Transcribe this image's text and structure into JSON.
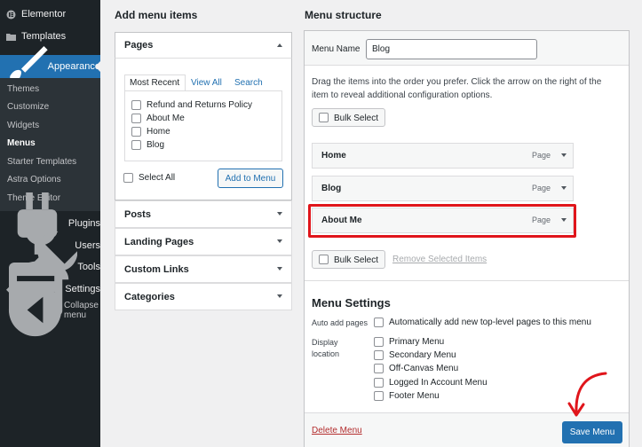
{
  "sidebar": {
    "elementor": "Elementor",
    "templates": "Templates",
    "appearance": "Appearance",
    "submenu": [
      "Themes",
      "Customize",
      "Widgets",
      "Menus",
      "Starter Templates",
      "Astra Options",
      "Theme Editor"
    ],
    "plugins": "Plugins",
    "users": "Users",
    "tools": "Tools",
    "settings": "Settings",
    "collapse": "Collapse menu"
  },
  "add_items": {
    "title": "Add menu items",
    "pages": {
      "label": "Pages",
      "tabs": [
        "Most Recent",
        "View All",
        "Search"
      ],
      "items": [
        "Refund and Returns Policy",
        "About Me",
        "Home",
        "Blog"
      ],
      "select_all": "Select All",
      "add_button": "Add to Menu"
    },
    "sections": [
      "Posts",
      "Landing Pages",
      "Custom Links",
      "Categories"
    ]
  },
  "structure": {
    "title": "Menu structure",
    "menu_name_label": "Menu Name",
    "menu_name_value": "Blog",
    "help_text": "Drag the items into the order you prefer. Click the arrow on the right of the item to reveal additional configuration options.",
    "bulk_select": "Bulk Select",
    "items": [
      {
        "title": "Home",
        "type": "Page"
      },
      {
        "title": "Blog",
        "type": "Page"
      },
      {
        "title": "About Me",
        "type": "Page"
      }
    ],
    "remove_selected": "Remove Selected Items"
  },
  "settings": {
    "title": "Menu Settings",
    "auto_add_label": "Auto add pages",
    "auto_add_option": "Automatically add new top-level pages to this menu",
    "display_location_label": "Display location",
    "locations": [
      "Primary Menu",
      "Secondary Menu",
      "Off-Canvas Menu",
      "Logged In Account Menu",
      "Footer Menu"
    ]
  },
  "footer": {
    "delete": "Delete Menu",
    "save": "Save Menu"
  },
  "colors": {
    "accent": "#2271b1",
    "highlight": "#e0151b",
    "sidebar": "#1d2327"
  }
}
